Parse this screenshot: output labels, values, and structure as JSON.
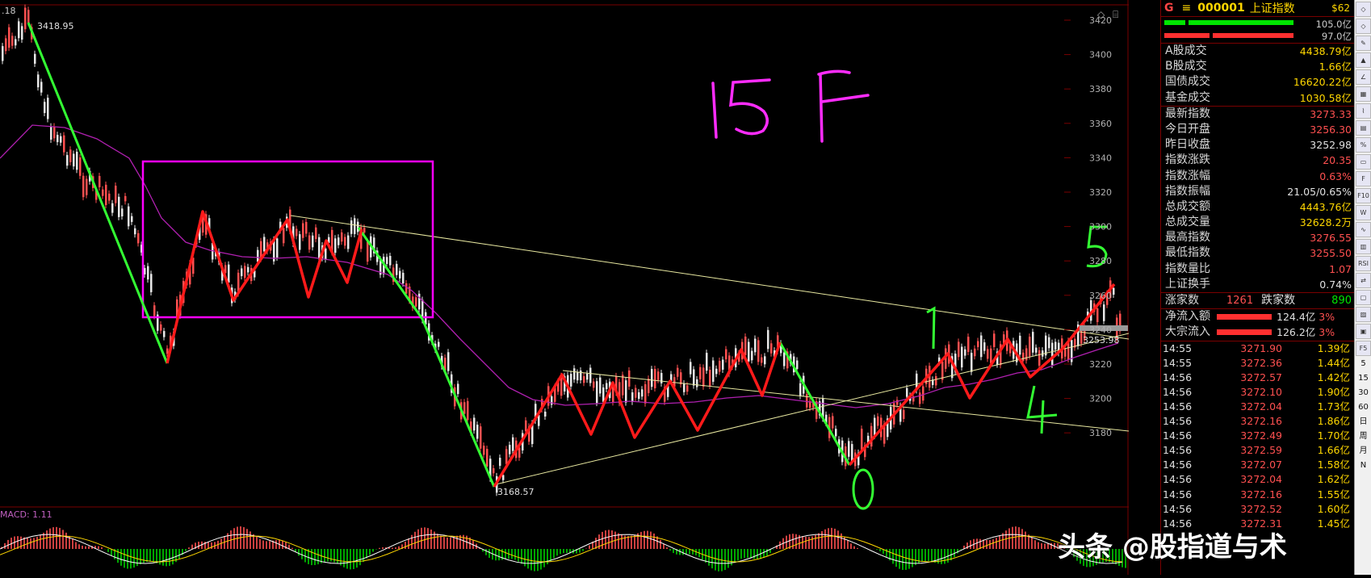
{
  "chart": {
    "corner_label": ".18",
    "y_axis_ticks": [
      "3420",
      "3400",
      "3380",
      "3360",
      "3340",
      "3320",
      "3300",
      "3280",
      "3260",
      "3240",
      "3220",
      "3200",
      "3180"
    ],
    "high_label": "3418.95",
    "low_label": "3168.57",
    "price_tag": "3253.98",
    "macd_label": "MACD: 1.11",
    "annotation_15f": "15F",
    "wave_labels": {
      "w0": "0",
      "w1": "1",
      "w4": "4",
      "w5": "5"
    },
    "colors": {
      "down_leg": "#33ff33",
      "up_leg": "#ff1a1a",
      "box": "#ff00ff",
      "ma": "#b020b0",
      "trend": "#e8e8a0"
    }
  },
  "panel": {
    "header": {
      "g": "G",
      "menu_icon": "hamburger-icon",
      "code": "000001",
      "name": "上证指数",
      "suffix": "$62"
    },
    "bars": {
      "top": "105.0亿",
      "bottom": "97.0亿"
    },
    "volume_rows": [
      {
        "label": "A股成交",
        "value": "4438.79亿"
      },
      {
        "label": "B股成交",
        "value": "1.66亿"
      },
      {
        "label": "国债成交",
        "value": "16620.22亿"
      },
      {
        "label": "基金成交",
        "value": "1030.58亿"
      }
    ],
    "index_rows": [
      {
        "label": "最新指数",
        "value": "3273.33",
        "color": "red"
      },
      {
        "label": "今日开盘",
        "value": "3256.30",
        "color": "red"
      },
      {
        "label": "昨日收盘",
        "value": "3252.98",
        "color": "wht"
      },
      {
        "label": "指数涨跌",
        "value": "20.35",
        "color": "red"
      },
      {
        "label": "指数涨幅",
        "value": "0.63%",
        "color": "red"
      },
      {
        "label": "指数振幅",
        "value": "21.05/0.65%",
        "color": "wht"
      },
      {
        "label": "总成交额",
        "value": "4443.76亿",
        "color": "yel"
      },
      {
        "label": "总成交量",
        "value": "32628.2万",
        "color": "yel"
      },
      {
        "label": "最高指数",
        "value": "3276.55",
        "color": "red"
      },
      {
        "label": "最低指数",
        "value": "3255.50",
        "color": "red"
      },
      {
        "label": "指数量比",
        "value": "1.07",
        "color": "red"
      },
      {
        "label": "上证换手",
        "value": "0.74%",
        "color": "wht"
      }
    ],
    "breadth": {
      "up_label": "涨家数",
      "up": "1261",
      "down_label": "跌家数",
      "down": "890"
    },
    "flows": [
      {
        "label": "净流入额",
        "value": "124.4亿",
        "pct": "3%"
      },
      {
        "label": "大宗流入",
        "value": "126.2亿",
        "pct": "3%"
      }
    ],
    "ticks": [
      {
        "t": "14:55",
        "p": "3271.90",
        "v": "1.39亿"
      },
      {
        "t": "14:55",
        "p": "3272.36",
        "v": "1.44亿"
      },
      {
        "t": "14:56",
        "p": "3272.57",
        "v": "1.42亿"
      },
      {
        "t": "14:56",
        "p": "3272.10",
        "v": "1.90亿"
      },
      {
        "t": "14:56",
        "p": "3272.04",
        "v": "1.73亿"
      },
      {
        "t": "14:56",
        "p": "3272.16",
        "v": "1.86亿"
      },
      {
        "t": "14:56",
        "p": "3272.49",
        "v": "1.70亿"
      },
      {
        "t": "14:56",
        "p": "3272.59",
        "v": "1.66亿"
      },
      {
        "t": "14:56",
        "p": "3272.07",
        "v": "1.58亿"
      },
      {
        "t": "14:56",
        "p": "3272.04",
        "v": "1.62亿"
      },
      {
        "t": "14:56",
        "p": "3272.16",
        "v": "1.55亿"
      },
      {
        "t": "14:56",
        "p": "3272.52",
        "v": "1.60亿"
      },
      {
        "t": "14:56",
        "p": "3272.31",
        "v": "1.45亿"
      }
    ]
  },
  "toolbar": {
    "buttons": [
      "◇",
      "◇",
      "✎",
      "▲",
      "∠",
      "▦",
      "⌇",
      "▤",
      "%",
      "▭",
      "F",
      "F10",
      "W",
      "∿",
      "▥",
      "RSI",
      "⇄",
      "▢",
      "▨",
      "▣",
      "F5"
    ],
    "periods": [
      "5",
      "15",
      "30",
      "60",
      "日",
      "周",
      "月",
      "N"
    ]
  },
  "watermark": "头条 @股指道与术"
}
